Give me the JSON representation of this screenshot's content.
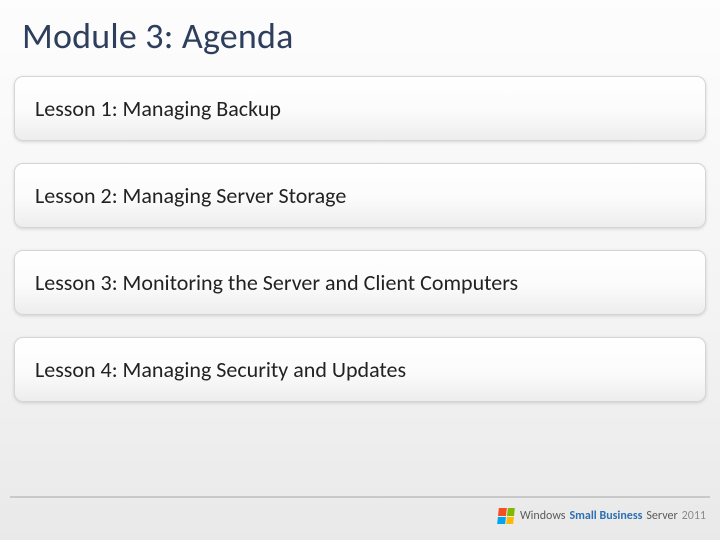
{
  "title": "Module 3: Agenda",
  "lessons": [
    {
      "label": "Lesson 1: Managing Backup"
    },
    {
      "label": "Lesson 2: Managing Server Storage"
    },
    {
      "label": "Lesson 3: Monitoring the Server and Client Computers"
    },
    {
      "label": "Lesson 4: Managing Security and Updates"
    }
  ],
  "brand": {
    "windows": "Windows",
    "sbs": "Small Business",
    "server": "Server",
    "year": "2011"
  }
}
